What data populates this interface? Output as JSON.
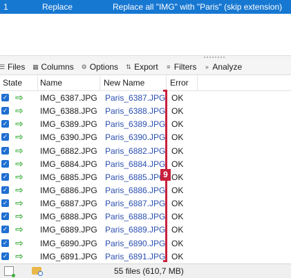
{
  "rule": {
    "number": "1",
    "action": "Replace",
    "description": "Replace all \"IMG\" with \"Paris\" (skip extension)"
  },
  "toolbar": {
    "files": "Files",
    "columns": "Columns",
    "options": "Options",
    "export": "Export",
    "filters": "Filters",
    "analyze": "Analyze"
  },
  "table": {
    "headers": {
      "state": "State",
      "name": "Name",
      "new_name": "New Name",
      "error": "Error"
    },
    "rows": [
      {
        "name": "IMG_6387.JPG",
        "new_name": "Paris_6387.JPG",
        "error": "OK"
      },
      {
        "name": "IMG_6388.JPG",
        "new_name": "Paris_6388.JPG",
        "error": "OK"
      },
      {
        "name": "IMG_6389.JPG",
        "new_name": "Paris_6389.JPG",
        "error": "OK"
      },
      {
        "name": "IMG_6390.JPG",
        "new_name": "Paris_6390.JPG",
        "error": "OK"
      },
      {
        "name": "IMG_6882.JPG",
        "new_name": "Paris_6882.JPG",
        "error": "OK"
      },
      {
        "name": "IMG_6884.JPG",
        "new_name": "Paris_6884.JPG",
        "error": "OK"
      },
      {
        "name": "IMG_6885.JPG",
        "new_name": "Paris_6885.JPG",
        "error": "OK"
      },
      {
        "name": "IMG_6886.JPG",
        "new_name": "Paris_6886.JPG",
        "error": "OK"
      },
      {
        "name": "IMG_6887.JPG",
        "new_name": "Paris_6887.JPG",
        "error": "OK"
      },
      {
        "name": "IMG_6888.JPG",
        "new_name": "Paris_6888.JPG",
        "error": "OK"
      },
      {
        "name": "IMG_6889.JPG",
        "new_name": "Paris_6889.JPG",
        "error": "OK"
      },
      {
        "name": "IMG_6890.JPG",
        "new_name": "Paris_6890.JPG",
        "error": "OK"
      },
      {
        "name": "IMG_6891.JPG",
        "new_name": "Paris_6891.JPG",
        "error": "OK"
      }
    ]
  },
  "annotation": {
    "marker": "9"
  },
  "status": {
    "text": "55 files (610,7 MB)"
  },
  "colors": {
    "selection": "#1778d2",
    "checkbox": "#1f6fd1",
    "arrow": "#3cae3c",
    "new_name_text": "#2a4fb0",
    "annotation": "#c7213c"
  },
  "icons": {
    "files": "files-icon",
    "columns": "columns-icon",
    "options": "options-icon",
    "export": "export-icon",
    "filters": "filters-icon",
    "analyze": "analyze-icon",
    "row_state": "checkbox-checked-icon",
    "row_arrow": "green-arrow-icon",
    "status_new": "new-file-icon",
    "status_folder": "folder-search-icon"
  }
}
